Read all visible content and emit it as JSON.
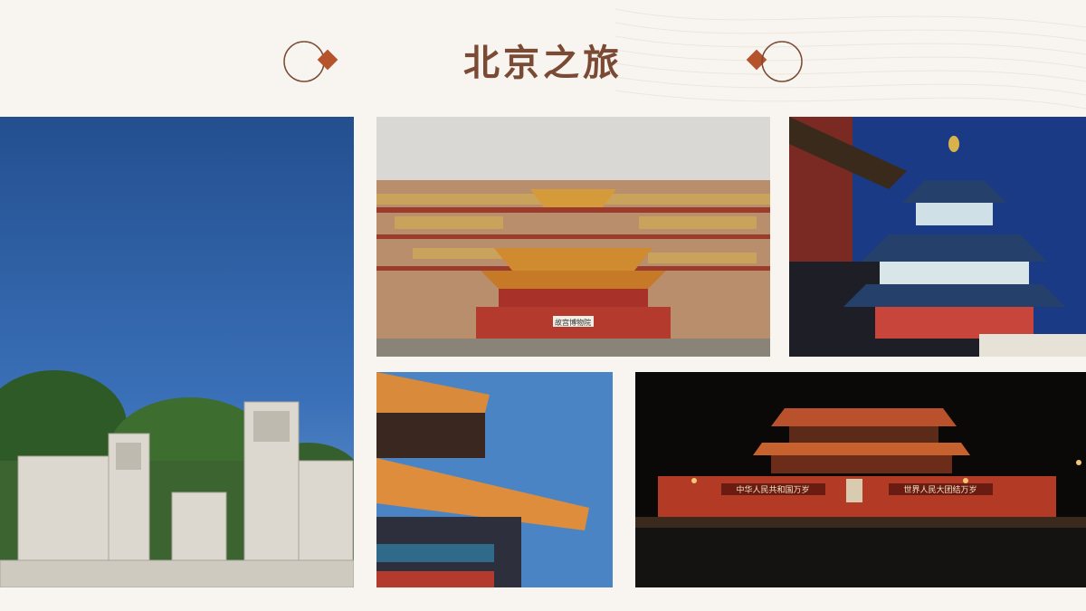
{
  "title": "北京之旅",
  "colors": {
    "background": "#f8f5f0",
    "title": "#7a4a35",
    "accent": "#b5532c",
    "ring": "#7a4a35"
  },
  "photos": [
    {
      "id": "yuanmingyuan-ruins",
      "icon": "photo-ruins"
    },
    {
      "id": "forbidden-city-overview",
      "icon": "photo-palace",
      "plaque_text": "故宫博物院"
    },
    {
      "id": "temple-of-heaven",
      "icon": "photo-temple"
    },
    {
      "id": "palace-roof-eaves",
      "icon": "photo-roof"
    },
    {
      "id": "tiananmen-night",
      "icon": "photo-tiananmen",
      "banner_left": "中华人民共和国万岁",
      "banner_right": "世界人民大团结万岁"
    }
  ]
}
